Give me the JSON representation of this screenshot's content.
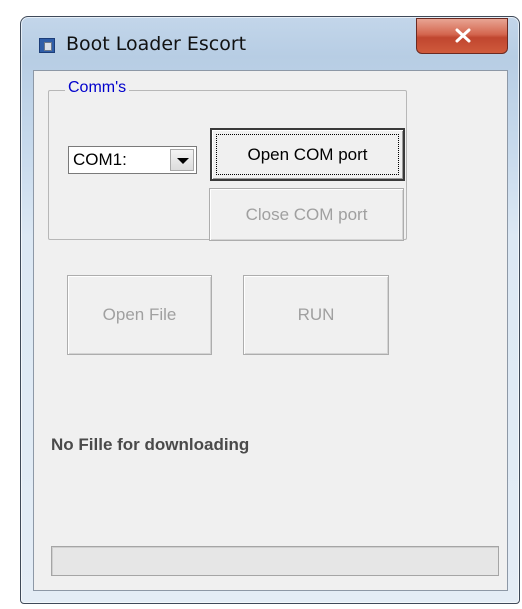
{
  "window": {
    "title": "Boot Loader Escort",
    "icon": "app-icon",
    "close_icon": "close-x-icon"
  },
  "comms": {
    "group_label": "Comm's",
    "port_select": {
      "selected": "COM1:"
    },
    "open_port_label": "Open COM port",
    "close_port_label": "Close COM port"
  },
  "actions": {
    "open_file_label": "Open File",
    "run_label": "RUN"
  },
  "status": {
    "message": "No Fille for downloading"
  },
  "progress": {
    "value": 0
  },
  "colors": {
    "group_label": "#0000cc",
    "disabled_text": "#a0a0a0",
    "close_button": "#c9513a"
  }
}
